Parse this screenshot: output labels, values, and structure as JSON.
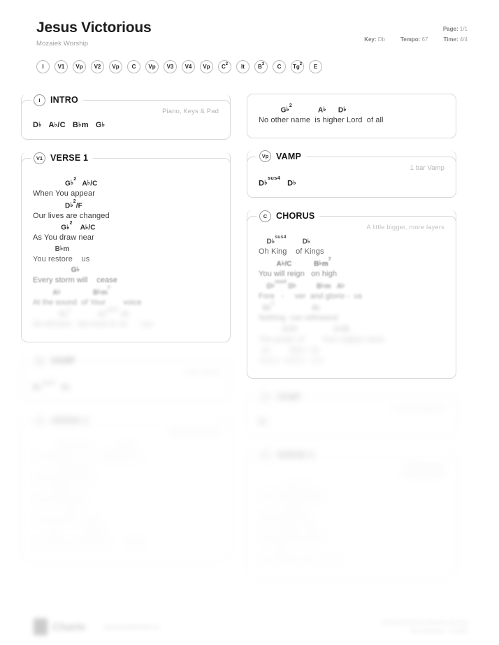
{
  "header": {
    "title": "Jesus Victorious",
    "artist": "Mozaiek Worship",
    "page_label": "Page:",
    "page_value": "1/1",
    "key_label": "Key:",
    "key_value": "Db",
    "tempo_label": "Tempo:",
    "tempo_value": "67",
    "time_label": "Time:",
    "time_value": "4/4"
  },
  "nav_pills": [
    {
      "label": "I",
      "sup": ""
    },
    {
      "label": "V1",
      "sup": ""
    },
    {
      "label": "Vp",
      "sup": ""
    },
    {
      "label": "V2",
      "sup": ""
    },
    {
      "label": "Vp",
      "sup": ""
    },
    {
      "label": "C",
      "sup": ""
    },
    {
      "label": "Vp",
      "sup": ""
    },
    {
      "label": "V3",
      "sup": ""
    },
    {
      "label": "V4",
      "sup": ""
    },
    {
      "label": "Vp",
      "sup": ""
    },
    {
      "label": "C",
      "sup": "2"
    },
    {
      "label": "It",
      "sup": ""
    },
    {
      "label": "B",
      "sup": "3"
    },
    {
      "label": "C",
      "sup": ""
    },
    {
      "label": "Tg",
      "sup": "2"
    },
    {
      "label": "E",
      "sup": ""
    }
  ],
  "left_column": {
    "intro": {
      "badge": "I",
      "title": "INTRO",
      "note": "Piano, Keys & Pad",
      "chords": "D♭   A♭/C   B♭m   G♭"
    },
    "verse1": {
      "badge": "V1",
      "title": "VERSE 1",
      "note": "",
      "lines": [
        {
          "chords": "                G♭2   A♭/C",
          "lyric": "When You appear",
          "fade": "f0"
        },
        {
          "chords": "                D♭2/F",
          "lyric": "Our lives are changed",
          "fade": "f0"
        },
        {
          "chords": "              G♭2    A♭/C",
          "lyric": "As You draw near",
          "fade": "f0"
        },
        {
          "chords": "           B♭m",
          "lyric": "You restore    us",
          "fade": "f1"
        },
        {
          "chords": "                   G♭",
          "lyric": "Every storm will    cease",
          "fade": "f2"
        },
        {
          "chords": "          A♭                B♭m7",
          "lyric": "At the sound  of Your        voice",
          "fade": "f3"
        },
        {
          "chords": "             G♭2              A♭sus4  A♭",
          "lyric": "All will bow   the knee to Je  -   sus",
          "fade": "f5"
        }
      ]
    },
    "vamp_a": {
      "badge": "Vp",
      "title": "VAMP",
      "note": "1 bar Vamp",
      "chords": "D♭sus4   D♭",
      "fade": "f5"
    },
    "verse2": {
      "badge": "V2",
      "title": "VERSE 2",
      "note": "Add soft sustain",
      "lines": [
        {
          "chords": "             G♭2  A♭/C              G♭/B",
          "lyric": "Unveiled by          unfailing love",
          "fade": "f6"
        },
        {
          "chords": "             G♭2  A♭/C",
          "lyric": "We give our lives",
          "fade": "f6"
        },
        {
          "chords": "           B♭m",
          "lyric": "In full surrender",
          "fade": "f6"
        },
        {
          "chords": "                 G♭",
          "lyric": "Enemies will    flee",
          "fade": "f6"
        },
        {
          "chords": "         A♭              B♭m7",
          "lyric": "As You tear  down the        walls",
          "fade": "f6"
        }
      ]
    }
  },
  "right_column": {
    "intro_cont": {
      "lines": [
        {
          "chords": "           G♭2             A♭      D♭",
          "lyric": "No other name  is higher Lord  of all",
          "fade": "f0"
        }
      ]
    },
    "vamp_b": {
      "badge": "Vp",
      "title": "VAMP",
      "note": "1 bar Vamp",
      "chords": "D♭sus4   D♭",
      "fade": "f0"
    },
    "chorus": {
      "badge": "C",
      "title": "CHORUS",
      "note": "A little bigger, more layers",
      "lines": [
        {
          "chords": "    D♭sus4        D♭",
          "lyric": "Oh King    of Kings",
          "fade": "f1"
        },
        {
          "chords": "         A♭/C           B♭m7",
          "lyric": "You will reign   on high",
          "fade": "f2"
        },
        {
          "chords": "    D♭sus4 D♭          B♭m   A♭",
          "lyric": "Fore   -     ver  and glorio -  us",
          "fade": "f3"
        },
        {
          "chords": "  G♭2                   A♭",
          "lyric": "Nothing  can withstand",
          "fade": "f4"
        },
        {
          "chords": "            D♭/F                  G♭/B",
          "lyric": "The power of        Your mighty name",
          "fade": "f5"
        },
        {
          "chords": "  A♭          B♭m   G♭",
          "lyric": "Jesus  victori - ous",
          "fade": "f6"
        }
      ]
    },
    "vamp_c": {
      "badge": "Vp",
      "title": "VAMP",
      "note": "1 bar breakdown",
      "chords": "D♭",
      "fade": "f6"
    },
    "verse3": {
      "badge": "V3",
      "title": "VERSE 3",
      "note": "Full dynamic\nLow dynamics",
      "lines": [
        {
          "chords": "              G♭   A♭",
          "lyric": "Your love and light",
          "fade": "f6"
        },
        {
          "chords": "              D♭/F",
          "lyric": "Will ever shine",
          "fade": "f6"
        },
        {
          "chords": "            B♭m     G♭",
          "lyric": "The darkness tried",
          "fade": "f6"
        },
        {
          "chords": "         A♭",
          "lyric": "But couldn't hold    You",
          "fade": "f6"
        }
      ]
    }
  },
  "footer": {
    "brand": "Charts",
    "url": "www.worshipcharts.co",
    "credit_line1": "Music and lyrics by Mozaiek Worship",
    "credit_line2": "CCLI Song No. 7123456"
  }
}
